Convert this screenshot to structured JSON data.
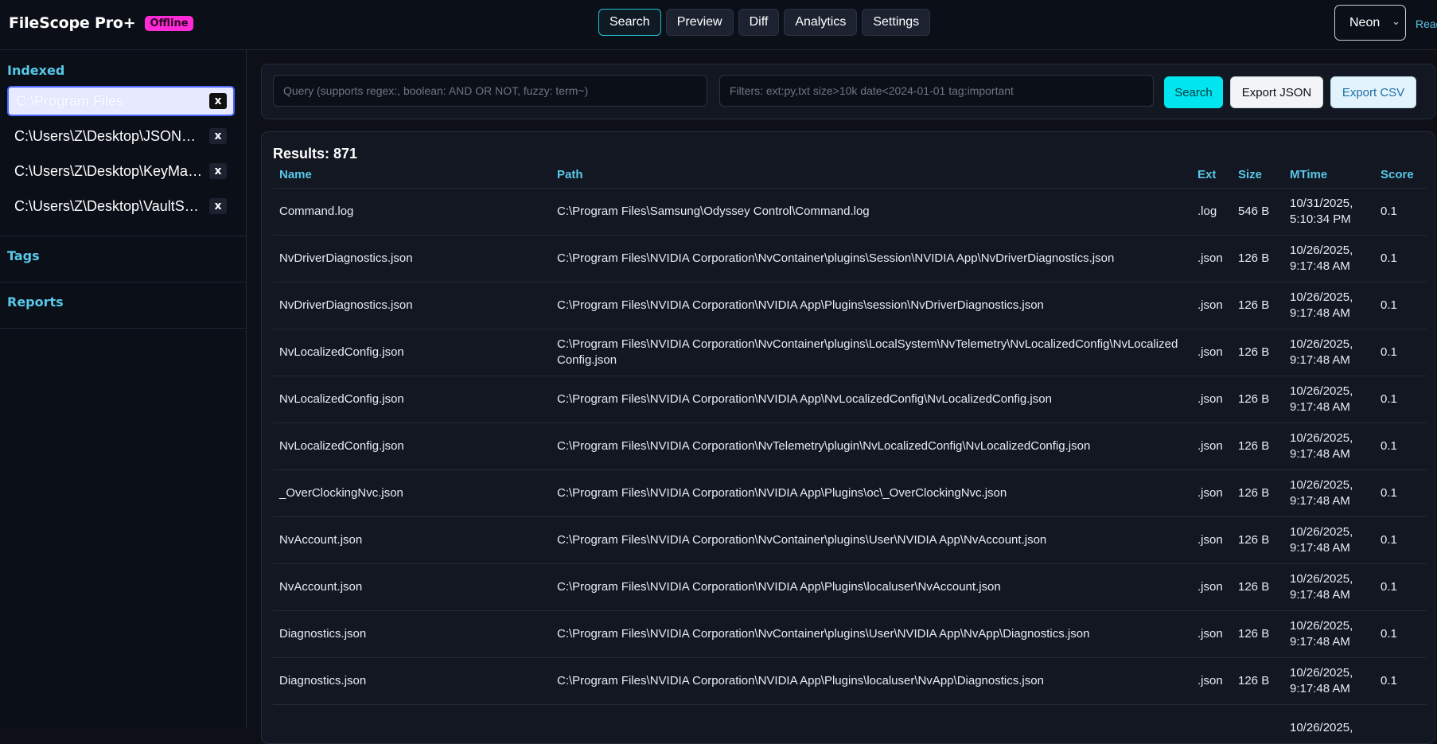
{
  "app": {
    "name": "FileScope Pro+",
    "status_badge": "Offline"
  },
  "tabs": [
    {
      "label": "Search",
      "active": true
    },
    {
      "label": "Preview",
      "active": false
    },
    {
      "label": "Diff",
      "active": false
    },
    {
      "label": "Analytics",
      "active": false
    },
    {
      "label": "Settings",
      "active": false
    }
  ],
  "theme": {
    "selected": "Neon"
  },
  "status_text": "Ready",
  "sidebar": {
    "indexed_title": "Indexed",
    "paths": [
      {
        "label": "C:\\Program Files",
        "remove": "x"
      },
      {
        "label": "C:\\Users\\Z\\Desktop\\JSONPil...",
        "remove": "x"
      },
      {
        "label": "C:\\Users\\Z\\Desktop\\KeyMap...",
        "remove": "x"
      },
      {
        "label": "C:\\Users\\Z\\Desktop\\VaultSyn...",
        "remove": "x"
      }
    ],
    "tags_title": "Tags",
    "reports_title": "Reports"
  },
  "search": {
    "query_placeholder": "Query (supports regex:, boolean: AND OR NOT, fuzzy: term~)",
    "filters_placeholder": "Filters: ext:py,txt size>10k date<2024-01-01 tag:important",
    "search_label": "Search",
    "export_json_label": "Export JSON",
    "export_csv_label": "Export CSV"
  },
  "results": {
    "count_label": "Results: 871",
    "columns": [
      "Name",
      "Path",
      "Ext",
      "Size",
      "MTime",
      "Score"
    ],
    "rows": [
      [
        "Command.log",
        "C:\\Program Files\\Samsung\\Odyssey Control\\Command.log",
        ".log",
        "546 B",
        "10/31/2025, 5:10:34 PM",
        "0.1"
      ],
      [
        "NvDriverDiagnostics.json",
        "C:\\Program Files\\NVIDIA Corporation\\NvContainer\\plugins\\Session\\NVIDIA App\\NvDriverDiagnostics.json",
        ".json",
        "126 B",
        "10/26/2025, 9:17:48 AM",
        "0.1"
      ],
      [
        "NvDriverDiagnostics.json",
        "C:\\Program Files\\NVIDIA Corporation\\NVIDIA App\\Plugins\\session\\NvDriverDiagnostics.json",
        ".json",
        "126 B",
        "10/26/2025, 9:17:48 AM",
        "0.1"
      ],
      [
        "NvLocalizedConfig.json",
        "C:\\Program Files\\NVIDIA Corporation\\NvContainer\\plugins\\LocalSystem\\NvTelemetry\\NvLocalizedConfig\\NvLocalizedConfig.json",
        ".json",
        "126 B",
        "10/26/2025, 9:17:48 AM",
        "0.1"
      ],
      [
        "NvLocalizedConfig.json",
        "C:\\Program Files\\NVIDIA Corporation\\NVIDIA App\\NvLocalizedConfig\\NvLocalizedConfig.json",
        ".json",
        "126 B",
        "10/26/2025, 9:17:48 AM",
        "0.1"
      ],
      [
        "NvLocalizedConfig.json",
        "C:\\Program Files\\NVIDIA Corporation\\NvTelemetry\\plugin\\NvLocalizedConfig\\NvLocalizedConfig.json",
        ".json",
        "126 B",
        "10/26/2025, 9:17:48 AM",
        "0.1"
      ],
      [
        "_OverClockingNvc.json",
        "C:\\Program Files\\NVIDIA Corporation\\NVIDIA App\\Plugins\\oc\\_OverClockingNvc.json",
        ".json",
        "126 B",
        "10/26/2025, 9:17:48 AM",
        "0.1"
      ],
      [
        "NvAccount.json",
        "C:\\Program Files\\NVIDIA Corporation\\NvContainer\\plugins\\User\\NVIDIA App\\NvAccount.json",
        ".json",
        "126 B",
        "10/26/2025, 9:17:48 AM",
        "0.1"
      ],
      [
        "NvAccount.json",
        "C:\\Program Files\\NVIDIA Corporation\\NVIDIA App\\Plugins\\localuser\\NvAccount.json",
        ".json",
        "126 B",
        "10/26/2025, 9:17:48 AM",
        "0.1"
      ],
      [
        "Diagnostics.json",
        "C:\\Program Files\\NVIDIA Corporation\\NvContainer\\plugins\\User\\NVIDIA App\\NvApp\\Diagnostics.json",
        ".json",
        "126 B",
        "10/26/2025, 9:17:48 AM",
        "0.1"
      ],
      [
        "Diagnostics.json",
        "C:\\Program Files\\NVIDIA Corporation\\NVIDIA App\\Plugins\\localuser\\NvApp\\Diagnostics.json",
        ".json",
        "126 B",
        "10/26/2025, 9:17:48 AM",
        "0.1"
      ],
      [
        "",
        "",
        "",
        "",
        "10/26/2025,",
        ""
      ]
    ]
  }
}
